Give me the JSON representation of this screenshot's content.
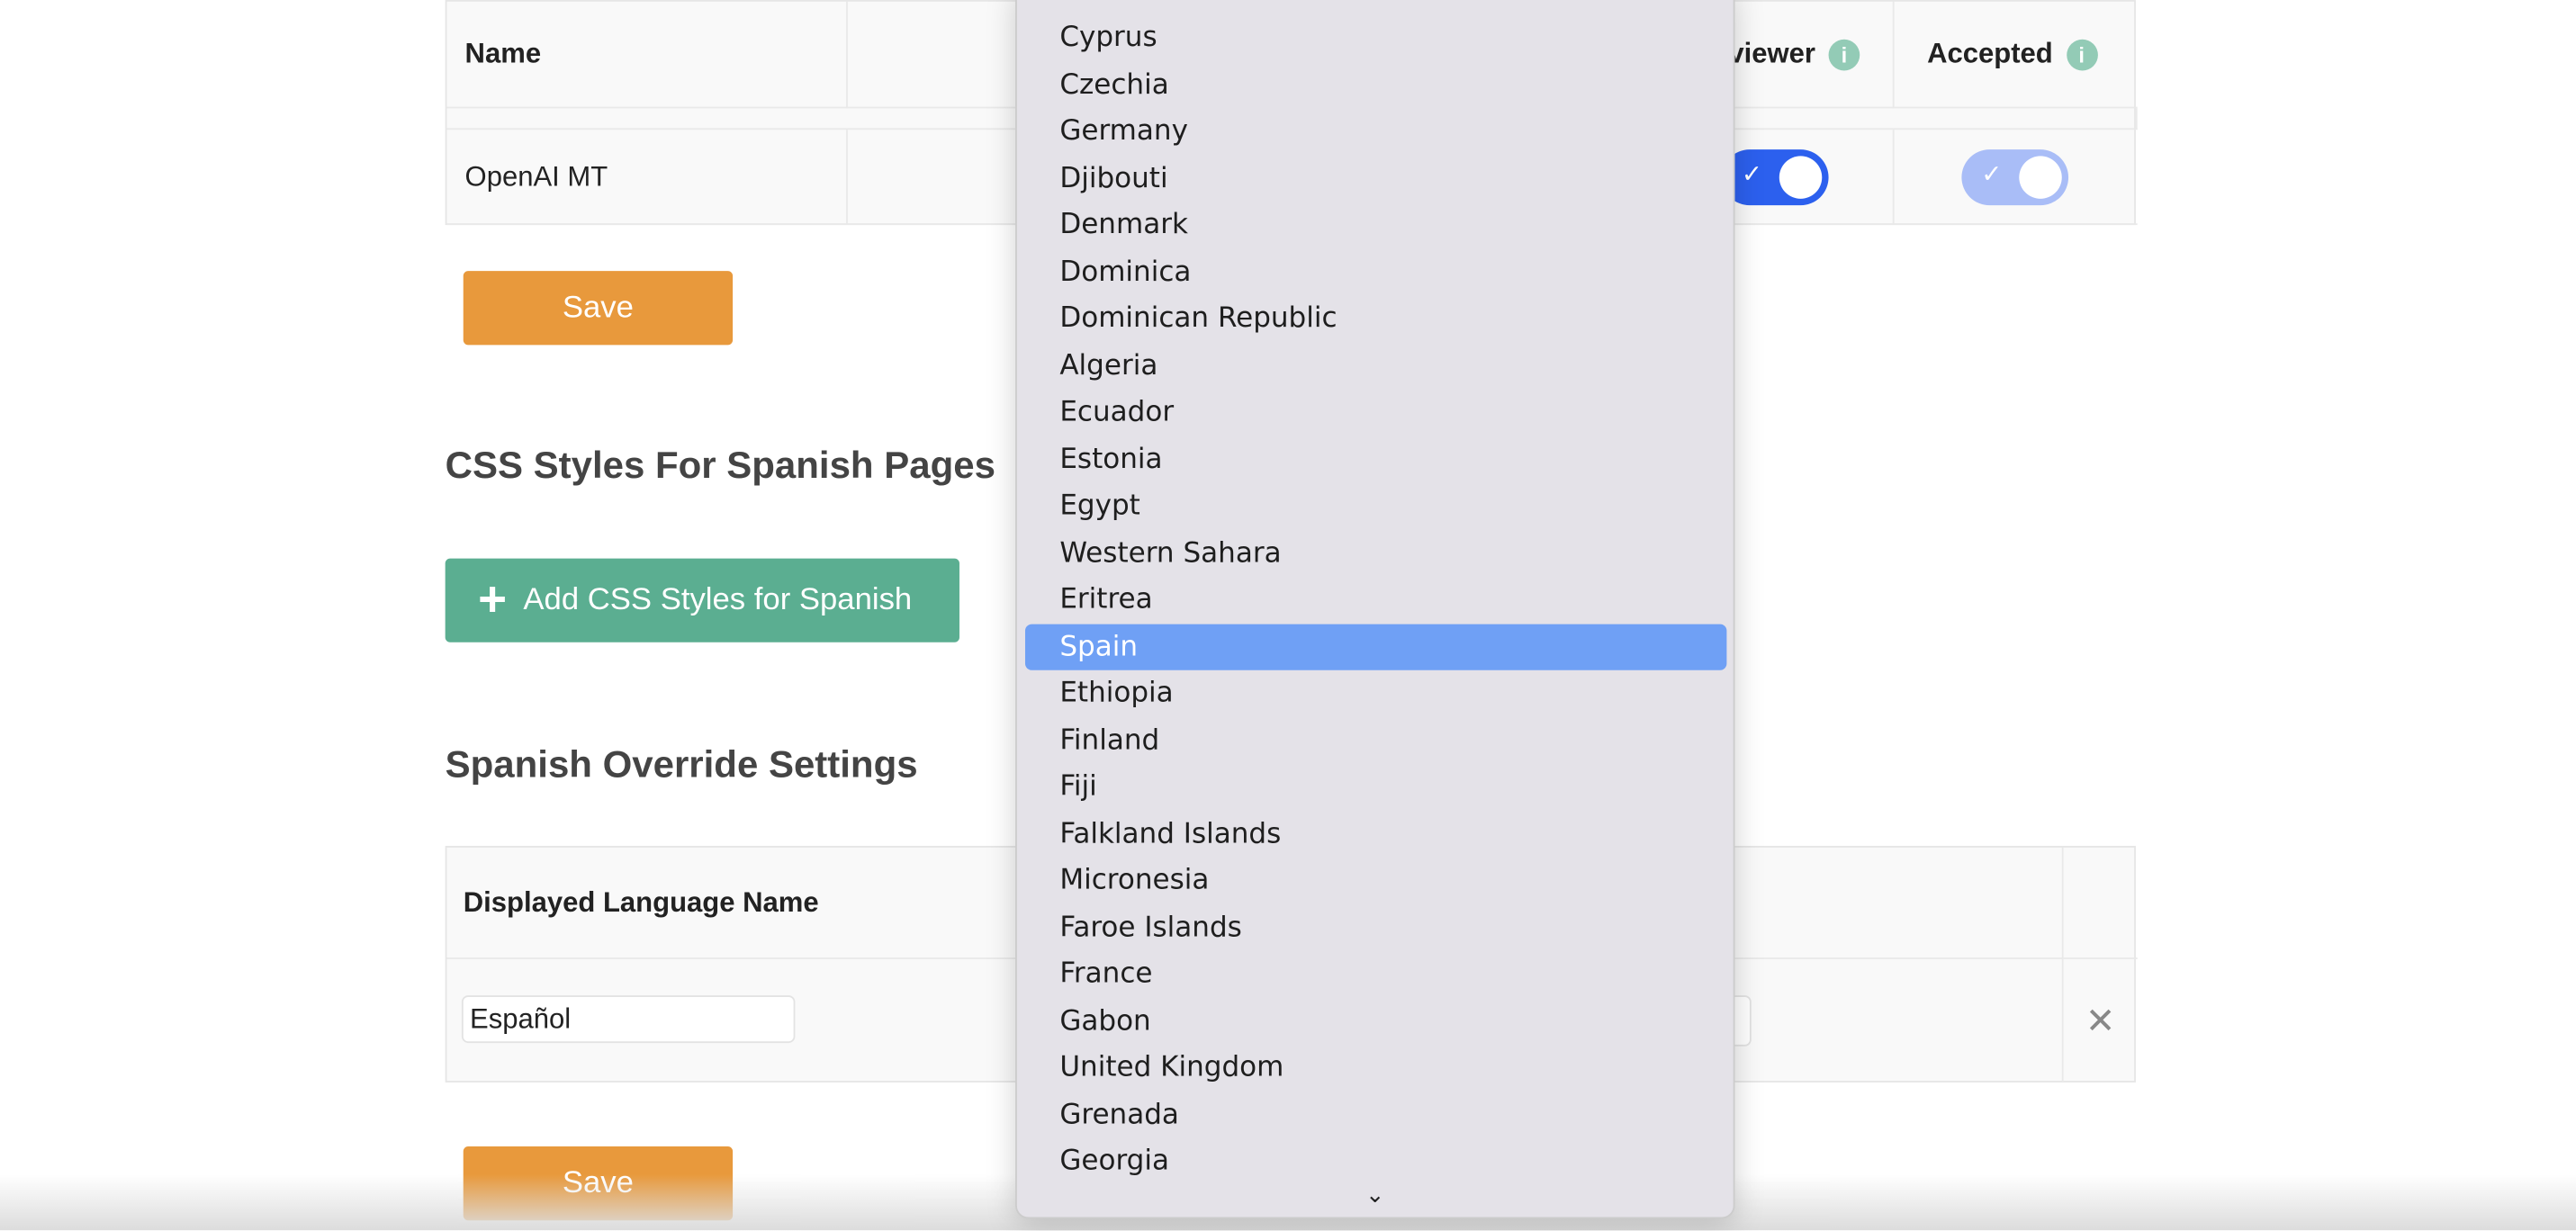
{
  "engines_table": {
    "headers": {
      "name": "Name",
      "reviewer": "Reviewer",
      "accepted": "Accepted"
    },
    "rows": [
      {
        "name": "OpenAI MT",
        "code": "openai",
        "reviewer": true,
        "accepted": true
      }
    ]
  },
  "save_label": "Save",
  "css_section": {
    "title": "CSS Styles For Spanish Pages",
    "add_button": "Add CSS Styles for Spanish"
  },
  "override_section": {
    "title": "Spanish Override Settings",
    "header": "Displayed Language Name",
    "row": {
      "language_name": "Español"
    }
  },
  "country_dropdown": {
    "selected": "Spain",
    "options": [
      "Cyprus",
      "Czechia",
      "Germany",
      "Djibouti",
      "Denmark",
      "Dominica",
      "Dominican Republic",
      "Algeria",
      "Ecuador",
      "Estonia",
      "Egypt",
      "Western Sahara",
      "Eritrea",
      "Spain",
      "Ethiopia",
      "Finland",
      "Fiji",
      "Falkland Islands",
      "Micronesia",
      "Faroe Islands",
      "France",
      "Gabon",
      "United Kingdom",
      "Grenada",
      "Georgia"
    ]
  },
  "colors": {
    "save": "#e8993c",
    "add": "#5bae91",
    "toggle_on": "#2c60ee",
    "toggle_disabled": "#a9bdf7",
    "highlight": "#6fa0f5"
  }
}
